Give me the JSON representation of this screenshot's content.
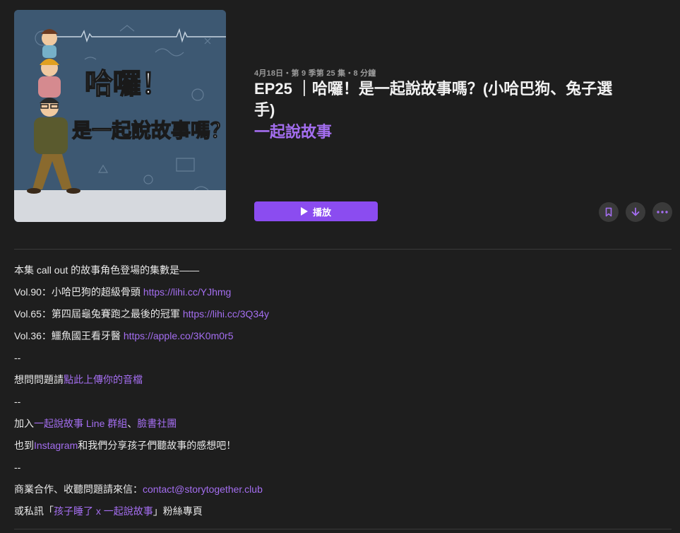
{
  "episode": {
    "meta": "4月18日・第 9 季第 25 集・8 分鐘",
    "title": "EP25 ｜哈囉！是一起說故事嗎？(小哈巴狗、兔子選手)",
    "show": "一起說故事",
    "artwork_text_line1": "哈囉！",
    "artwork_text_line2": "是一起說故事嗎？"
  },
  "actions": {
    "play_label": "播放",
    "bookmark_icon": "bookmark-icon",
    "download_icon": "download-icon",
    "more_icon": "more-icon"
  },
  "colors": {
    "accent": "#8b4cf0",
    "link": "#a46ef0",
    "background": "#1e1e1e"
  },
  "description": {
    "l1": "本集 call out 的故事角色登場的集數是——",
    "l2_text": "Vol.90：小哈巴狗的超級骨頭 ",
    "l2_link": "https://lihi.cc/YJhmg",
    "l3_text": "Vol.65：第四屆龜兔賽跑之最後的冠軍 ",
    "l3_link": "https://lihi.cc/3Q34y",
    "l4_text": "Vol.36：鱷魚國王看牙醫 ",
    "l4_link": "https://apple.co/3K0m0r5",
    "sep1": "--",
    "l5_text": "想問問題請",
    "l5_link": "點此上傳你的音檔",
    "sep2": "--",
    "l6_a": "加入",
    "l6_link1": "一起說故事 Line 群組",
    "l6_b": "、",
    "l6_link2": "臉書社團",
    "l7_a": "也到",
    "l7_link": "Instagram",
    "l7_b": "和我們分享孩子們聽故事的感想吧！",
    "sep3": "--",
    "l8_text": "商業合作、收聽問題請來信：",
    "l8_link": "contact@storytogether.club",
    "l9_a": "或私訊「",
    "l9_link": "孩子睡了 x 一起說故事",
    "l9_b": "」粉絲專頁"
  }
}
